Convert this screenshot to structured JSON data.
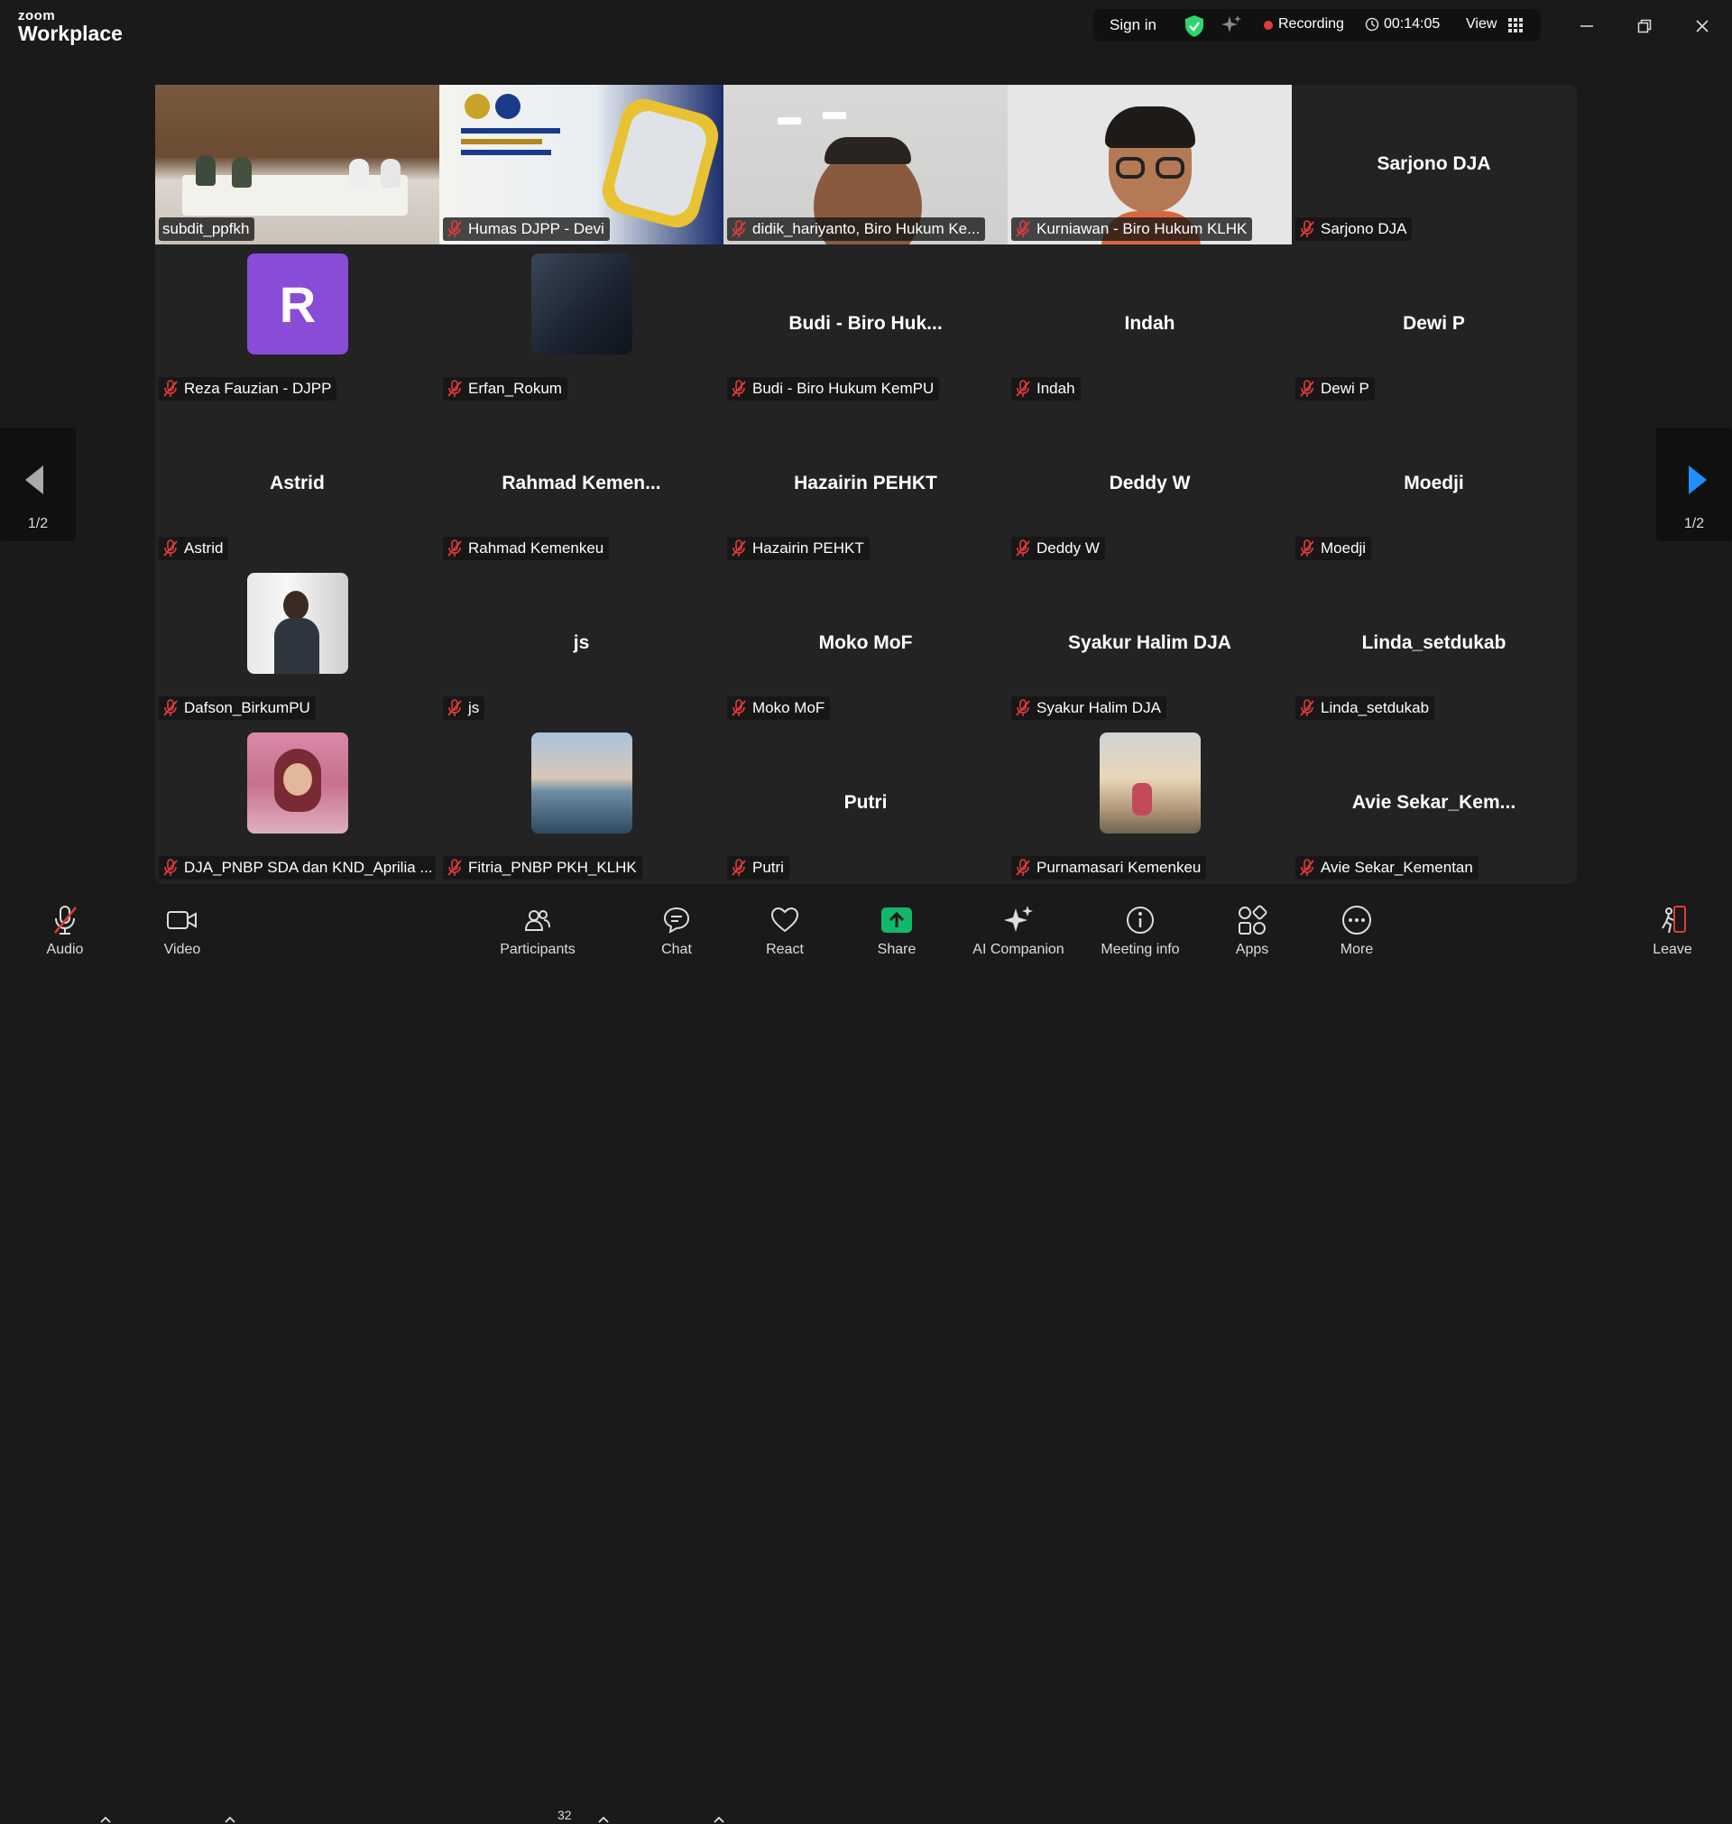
{
  "app": {
    "logo_line1": "zoom",
    "logo_line2": "Workplace"
  },
  "topbar": {
    "sign_in": "Sign in",
    "recording": "Recording",
    "timer": "00:14:05",
    "view": "View"
  },
  "colors": {
    "active_speaker": "#2bd66a",
    "mic_muted": "#e33b3b",
    "share_green": "#12b86a",
    "arrow_blue": "#1e90ff"
  },
  "gallery": {
    "page_left": "1/2",
    "page_right": "1/2",
    "participants": [
      {
        "label": "subdit_ppfkh",
        "display": "",
        "muted": false,
        "video": "room"
      },
      {
        "label": "Humas DJPP - Devi",
        "display": "",
        "muted": true,
        "video": "slide"
      },
      {
        "label": "didik_hariyanto, Biro Hukum Ke...",
        "display": "",
        "muted": true,
        "video": "face"
      },
      {
        "label": "Kurniawan - Biro Hukum KLHK",
        "display": "",
        "muted": true,
        "video": "avatar3d"
      },
      {
        "label": "Sarjono DJA",
        "display": "Sarjono DJA",
        "muted": true,
        "video": ""
      },
      {
        "label": "Reza Fauzian - DJPP",
        "display": "R",
        "muted": true,
        "video": "initial"
      },
      {
        "label": "Erfan_Rokum",
        "display": "",
        "muted": true,
        "video": "dark"
      },
      {
        "label": "Budi - Biro Hukum KemPU",
        "display": "Budi - Biro Huk...",
        "muted": true,
        "video": ""
      },
      {
        "label": "Indah",
        "display": "Indah",
        "muted": true,
        "video": ""
      },
      {
        "label": "Dewi P",
        "display": "Dewi P",
        "muted": true,
        "video": ""
      },
      {
        "label": "Astrid",
        "display": "Astrid",
        "muted": true,
        "video": ""
      },
      {
        "label": "Rahmad Kemenkeu",
        "display": "Rahmad Kemen...",
        "muted": true,
        "video": ""
      },
      {
        "label": "Hazairin PEHKT",
        "display": "Hazairin PEHKT",
        "muted": true,
        "video": ""
      },
      {
        "label": "Deddy W",
        "display": "Deddy W",
        "muted": true,
        "video": ""
      },
      {
        "label": "Moedji",
        "display": "Moedji",
        "muted": true,
        "video": ""
      },
      {
        "label": "Dafson_BirkumPU",
        "display": "",
        "muted": true,
        "video": "photo-man"
      },
      {
        "label": "js",
        "display": "js",
        "muted": true,
        "video": ""
      },
      {
        "label": "Moko MoF",
        "display": "Moko MoF",
        "muted": true,
        "video": ""
      },
      {
        "label": "Syakur Halim DJA",
        "display": "Syakur Halim DJA",
        "muted": true,
        "video": ""
      },
      {
        "label": "Linda_setdukab",
        "display": "Linda_setdukab",
        "muted": true,
        "video": ""
      },
      {
        "label": "DJA_PNBP SDA dan KND_Aprilia ...",
        "display": "",
        "muted": true,
        "video": "photo-hijab"
      },
      {
        "label": "Fitria_PNBP PKH_KLHK",
        "display": "",
        "muted": true,
        "video": "photo-beach"
      },
      {
        "label": "Putri",
        "display": "Putri",
        "muted": true,
        "video": ""
      },
      {
        "label": "Purnamasari Kemenkeu",
        "display": "",
        "muted": true,
        "video": "photo-sunset"
      },
      {
        "label": "Avie Sekar_Kementan",
        "display": "Avie Sekar_Kem...",
        "muted": true,
        "video": ""
      }
    ]
  },
  "toolbar": {
    "audio": "Audio",
    "video": "Video",
    "participants": "Participants",
    "participants_count": "32",
    "chat": "Chat",
    "react": "React",
    "share": "Share",
    "ai_companion": "AI Companion",
    "meeting_info": "Meeting info",
    "apps": "Apps",
    "more": "More",
    "leave": "Leave"
  }
}
